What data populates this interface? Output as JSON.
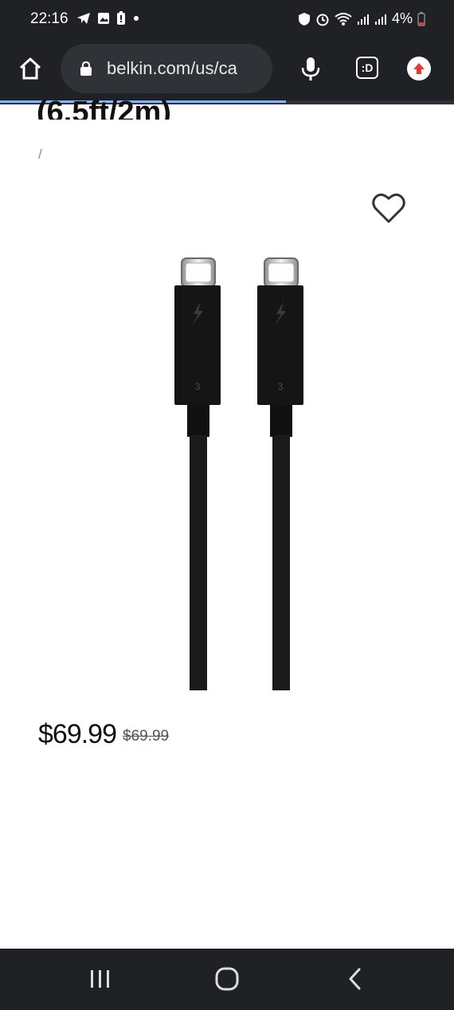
{
  "status_bar": {
    "time": "22:16",
    "battery": "4%",
    "left_icons": [
      "telegram-icon",
      "image-icon",
      "battery-alert-icon",
      "dot-icon"
    ],
    "right_icons": [
      "shield-icon",
      "alarm-icon",
      "wifi-icon",
      "signal-icon",
      "signal-icon",
      "battery-icon"
    ]
  },
  "browser": {
    "url": "belkin.com/us/ca",
    "tab_count": ":D",
    "load_progress": 0.63
  },
  "product": {
    "title_partial": "(6.5ft/2m)",
    "breadcrumb": "/",
    "price": "$69.99",
    "old_price": "$69.99",
    "image": "thunderbolt-3-cable",
    "connector_label": "3"
  },
  "colors": {
    "chrome": "#1f2124",
    "accent": "#8ab4f8",
    "upload_badge": "#e53935"
  }
}
